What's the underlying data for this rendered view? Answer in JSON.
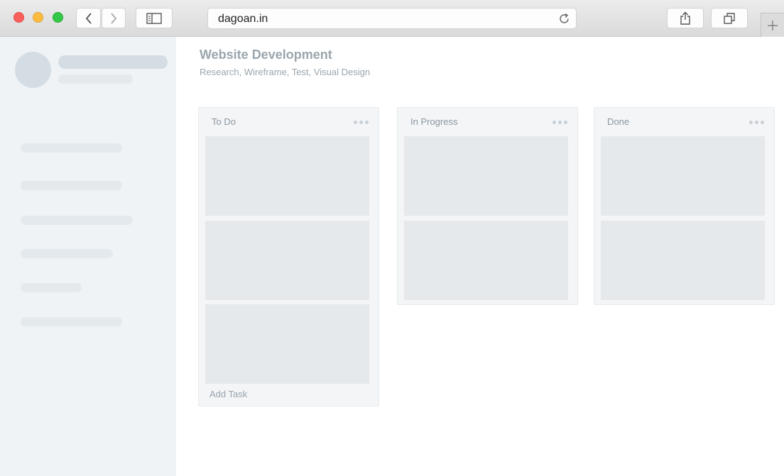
{
  "browser": {
    "url": "dagoan.in"
  },
  "project": {
    "title": "Website Development",
    "subtitle": "Research, Wireframe, Test, Visual Design"
  },
  "columns": [
    {
      "title": "To Do",
      "card_count": 3,
      "footer": "Add Task"
    },
    {
      "title": "In Progress",
      "card_count": 2
    },
    {
      "title": "Done",
      "card_count": 2
    }
  ],
  "colors": {
    "sidebar_bg": "#eff3f6",
    "column_bg": "#f3f5f7",
    "card_bg": "#e5e9ec",
    "muted_text": "#9aa5ad"
  }
}
